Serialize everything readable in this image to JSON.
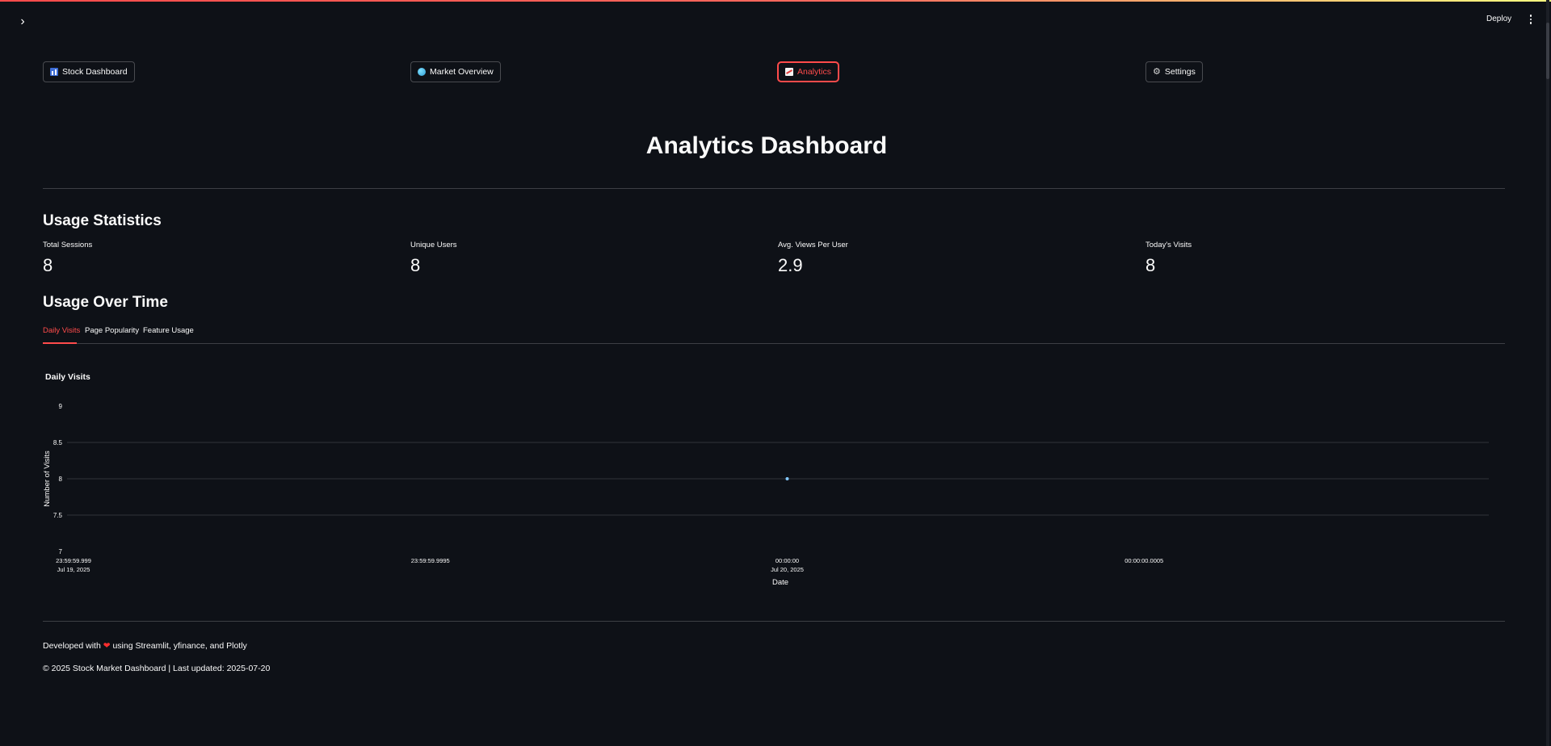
{
  "header": {
    "deploy_label": "Deploy",
    "sidebar_toggle_glyph": "›",
    "menu_icon": "kebab-menu-icon"
  },
  "nav": {
    "buttons": [
      {
        "label": "Stock Dashboard",
        "icon": "bar-chart-icon"
      },
      {
        "label": "Market Overview",
        "icon": "globe-icon"
      },
      {
        "label": "Analytics",
        "icon": "trend-chart-icon",
        "active": true
      },
      {
        "label": "Settings",
        "icon": "gear-icon"
      }
    ],
    "active_color": "#ff4b4b"
  },
  "page": {
    "title": "Analytics Dashboard"
  },
  "usage_statistics": {
    "heading": "Usage Statistics",
    "metrics": [
      {
        "label": "Total Sessions",
        "value": "8"
      },
      {
        "label": "Unique Users",
        "value": "8"
      },
      {
        "label": "Avg. Views Per User",
        "value": "2.9"
      },
      {
        "label": "Today's Visits",
        "value": "8"
      }
    ]
  },
  "usage_over_time": {
    "heading": "Usage Over Time",
    "tabs": [
      {
        "label": "Daily Visits",
        "active": true
      },
      {
        "label": "Page Popularity"
      },
      {
        "label": "Feature Usage"
      }
    ]
  },
  "chart_data": {
    "type": "scatter",
    "title": "Daily Visits",
    "xlabel": "Date",
    "ylabel": "Number of Visits",
    "x_tick_labels": [
      {
        "line1": "23:59:59.999",
        "line2": "Jul 19, 2025"
      },
      {
        "line1": "23:59:59.9995",
        "line2": ""
      },
      {
        "line1": "00:00:00",
        "line2": "Jul 20, 2025"
      },
      {
        "line1": "00:00:00.0005",
        "line2": ""
      }
    ],
    "y_ticks": [
      "9",
      "8.5",
      "8",
      "7.5",
      "7"
    ],
    "ylim": [
      7,
      9
    ],
    "points": [
      {
        "x": "2025-07-20",
        "y": 8
      }
    ],
    "marker_color": "#83c9ff",
    "grid": true
  },
  "footer": {
    "dev_prefix": "Developed with",
    "heart": "❤",
    "dev_suffix": "using Streamlit, yfinance, and Plotly",
    "copyright": "© 2025 Stock Market Dashboard | Last updated: 2025-07-20"
  }
}
